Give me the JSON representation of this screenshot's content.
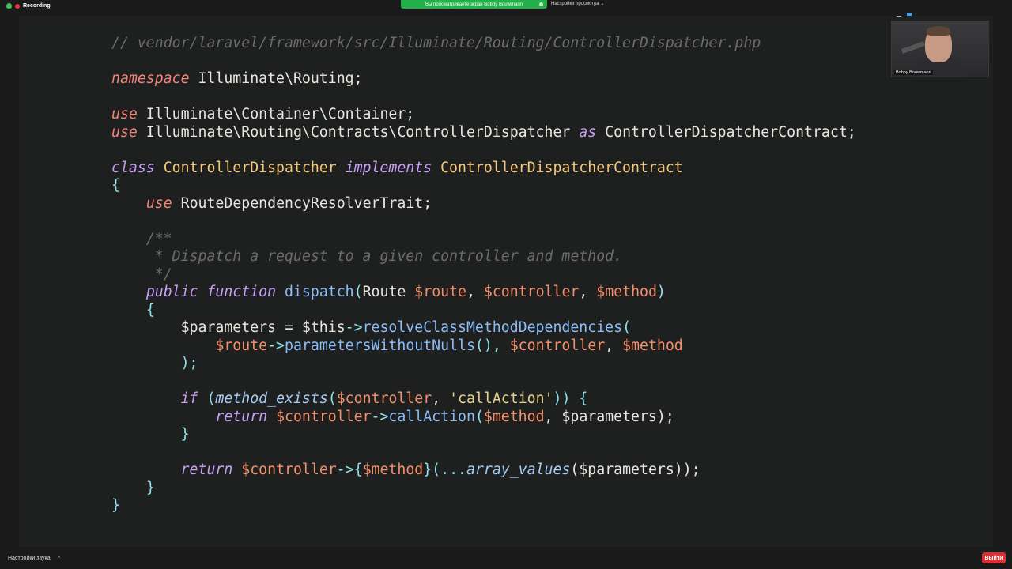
{
  "recording": {
    "label": "Recording"
  },
  "share_banner": {
    "text": "Вы просматриваете экран Bobby Bouwmann"
  },
  "view_options": {
    "label": "Настройки просмотра ⌄"
  },
  "participant": {
    "name": "Bobby Bouwmann"
  },
  "bottom": {
    "audio_settings": "Настройки звука",
    "audio_chevron": "⌃",
    "exit_label": "Выйти"
  },
  "colors": {
    "exit": "#d93036",
    "banner": "#23b04a",
    "record": "#e5373d"
  },
  "code": {
    "l1": "// vendor/laravel/framework/src/Illuminate/Routing/ControllerDispatcher.php",
    "l3_kw": "namespace",
    "l3_rest": " Illuminate\\Routing;",
    "l5_kw": "use",
    "l5_rest": " Illuminate\\Container\\Container;",
    "l6_kw": "use",
    "l6_a": " Illuminate\\Routing\\Contracts\\ControllerDispatcher ",
    "l6_as": "as",
    "l6_b": " ControllerDispatcherContract;",
    "l8_kw": "class",
    "l8_cls": "ControllerDispatcher",
    "l8_impl": "implements",
    "l8_iface": "ControllerDispatcherContract",
    "l9": "{",
    "l10_kw": "use",
    "l10_rest": " RouteDependencyResolverTrait;",
    "l12": "/**",
    "l13": " * Dispatch a request to a given controller and method.",
    "l14": " */",
    "l15_pub": "public",
    "l15_fn": "function",
    "l15_name": "dispatch",
    "l15_p1": "(",
    "l15_route_t": "Route ",
    "l15_route": "$route",
    "l15_c1": ", ",
    "l15_ctrl": "$controller",
    "l15_c2": ", ",
    "l15_meth": "$method",
    "l15_p2": ")",
    "l16": "{",
    "l17_var": "$parameters = $this",
    "l17_arr": "->",
    "l17_fn": "resolveClassMethodDependencies",
    "l17_p": "(",
    "l18_route": "$route",
    "l18_arr": "->",
    "l18_fn": "parametersWithoutNulls",
    "l18_mid": "(), ",
    "l18_ctrl": "$controller",
    "l18_c": ", ",
    "l18_meth": "$method",
    "l19": ");",
    "l21_if": "if",
    "l21_p": " (",
    "l21_fn": "method_exists",
    "l21_p2": "(",
    "l21_ctrl": "$controller",
    "l21_c": ", ",
    "l21_str": "'callAction'",
    "l21_end": ")) {",
    "l22_ret": "return",
    "l22_ctrl": "$controller",
    "l22_arr": "->",
    "l22_fn": "callAction",
    "l22_p": "(",
    "l22_meth": "$method",
    "l22_c": ", $parameters);",
    "l23": "}",
    "l25_ret": "return",
    "l25_ctrl": "$controller",
    "l25_arr": "->{",
    "l25_meth": "$method",
    "l25_mid": "}(...",
    "l25_fn": "array_values",
    "l25_end": "($parameters));",
    "l26": "}",
    "l27": "}"
  }
}
